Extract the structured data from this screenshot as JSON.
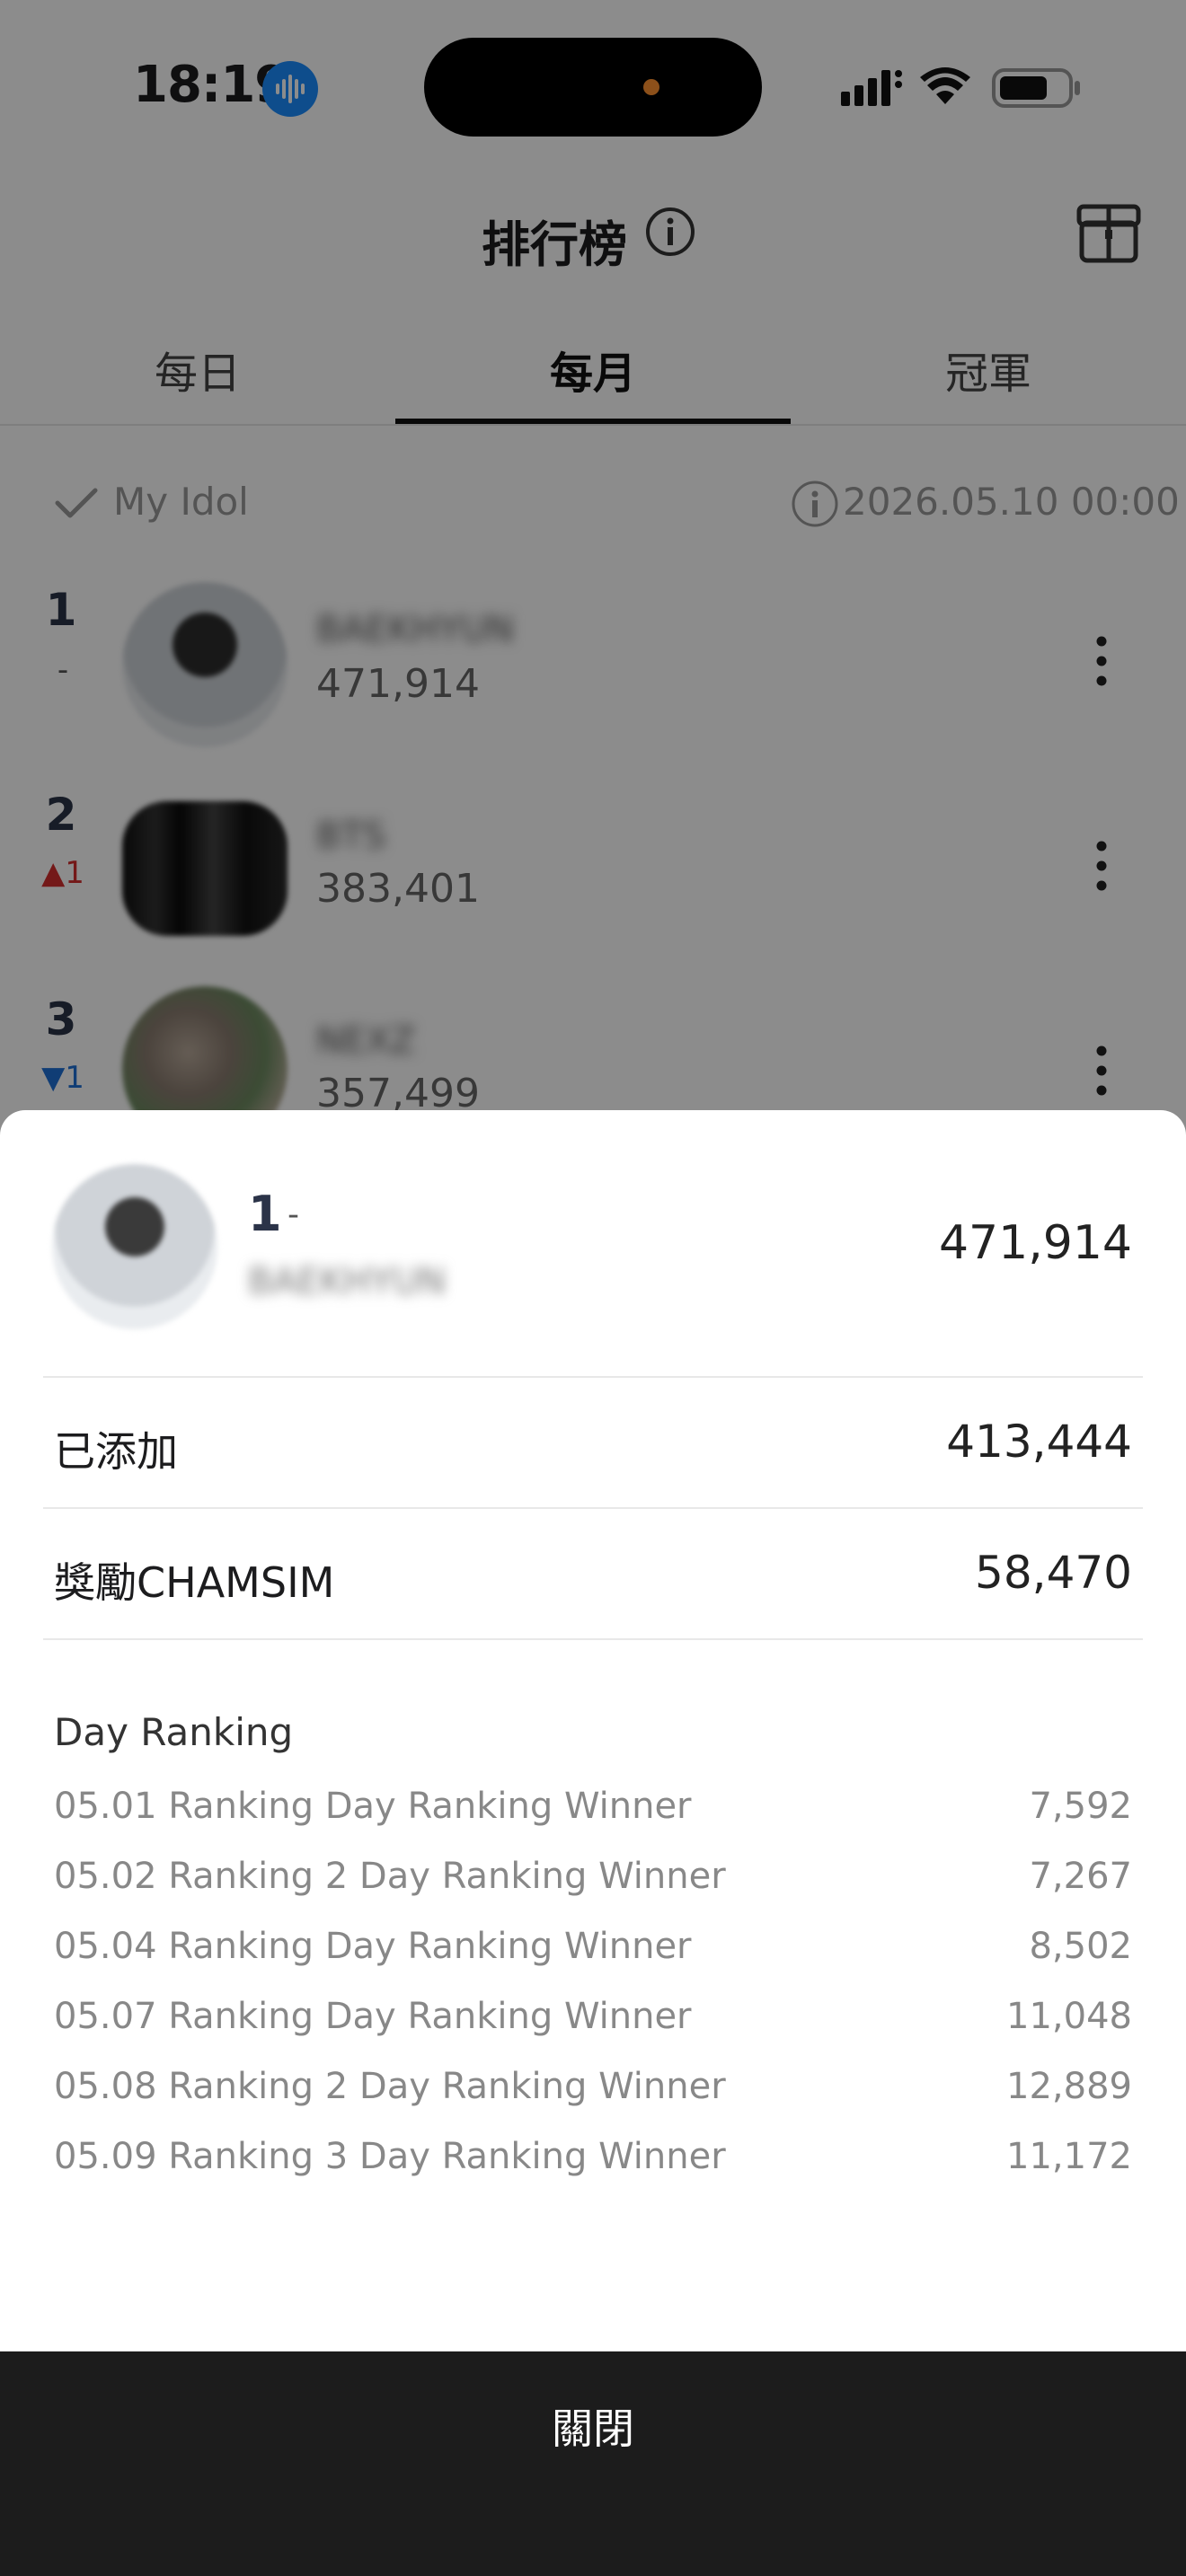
{
  "status_bar": {
    "time": "18:19"
  },
  "header": {
    "title": "排行榜"
  },
  "tabs": [
    {
      "label": "每日"
    },
    {
      "label": "每月"
    },
    {
      "label": "冠軍"
    }
  ],
  "filter": {
    "my_idol_label": "My Idol",
    "timestamp": "2026.05.10 00:00"
  },
  "ranking": [
    {
      "rank": "1",
      "change": "-",
      "name": "BAEKHYUN",
      "votes": "471,914"
    },
    {
      "rank": "2",
      "change": "▲1",
      "name": "BTS",
      "votes": "383,401"
    },
    {
      "rank": "3",
      "change": "▼1",
      "name": "NEXZ",
      "votes": "357,499"
    }
  ],
  "sheet": {
    "rank": "1",
    "rank_change": "-",
    "name": "BAEKHYUN",
    "total": "471,914",
    "added_label": "已添加",
    "added_value": "413,444",
    "bonus_label": "獎勵CHAMSIM",
    "bonus_value": "58,470",
    "day_ranking_title": "Day Ranking",
    "day_rankings": [
      {
        "label": "05.01 Ranking Day Ranking Winner",
        "value": "7,592"
      },
      {
        "label": "05.02 Ranking 2 Day Ranking Winner",
        "value": "7,267"
      },
      {
        "label": "05.04 Ranking Day Ranking Winner",
        "value": "8,502"
      },
      {
        "label": "05.07 Ranking Day Ranking Winner",
        "value": "11,048"
      },
      {
        "label": "05.08 Ranking 2 Day Ranking Winner",
        "value": "12,889"
      },
      {
        "label": "05.09 Ranking 3 Day Ranking Winner",
        "value": "11,172"
      }
    ],
    "close_label": "關閉"
  },
  "colors": {
    "accent_blue": "#1a8cff",
    "rank_up": "#d32f2f",
    "rank_down": "#1e6fd6",
    "close_bar": "#1c1c1c"
  }
}
